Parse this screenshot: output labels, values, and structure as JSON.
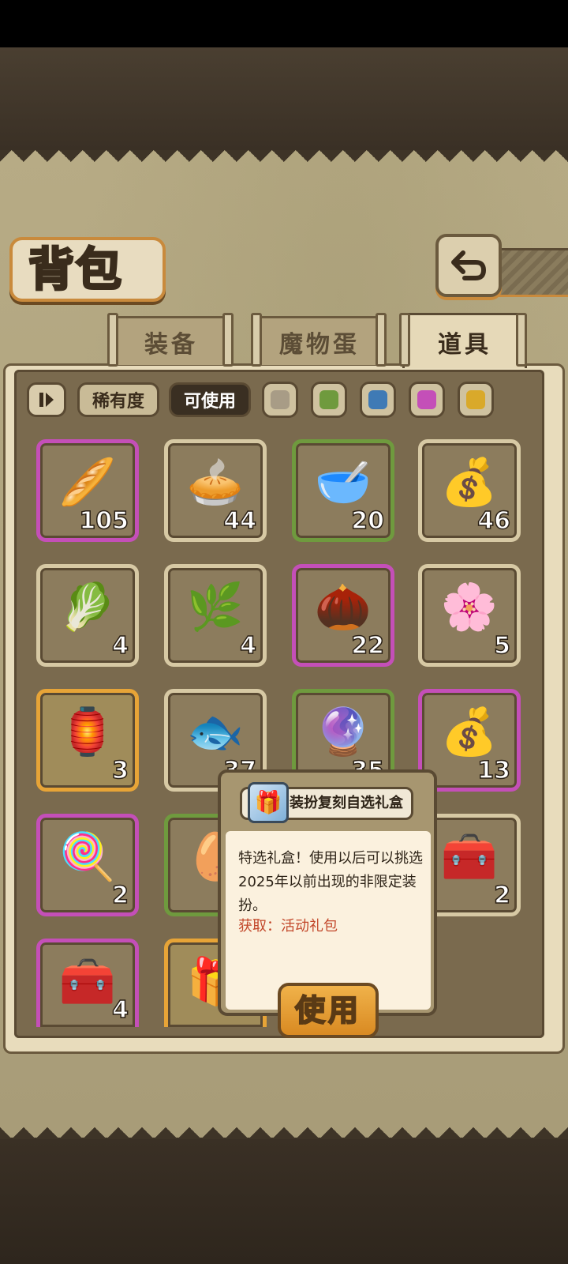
{
  "header": {
    "title": "背包"
  },
  "tabs": [
    {
      "label": "装备",
      "active": false
    },
    {
      "label": "魔物蛋",
      "active": false
    },
    {
      "label": "道具",
      "active": true
    }
  ],
  "filters": {
    "rarity_label": "稀有度",
    "usable_label": "可使用",
    "swatch_colors": [
      "#a89c86",
      "#6f9a3e",
      "#3f7ab5",
      "#c44fb8",
      "#d9a92a"
    ]
  },
  "items": [
    {
      "icon": "bread-basket-icon",
      "glyph": "🥖",
      "count": "105",
      "rarity": "purple"
    },
    {
      "icon": "seaweed-pie-icon",
      "glyph": "🥧",
      "count": "44",
      "rarity": "common"
    },
    {
      "icon": "water-bowl-icon",
      "glyph": "🥣",
      "count": "20",
      "rarity": "green"
    },
    {
      "icon": "coin-sack-icon",
      "glyph": "💰",
      "count": "46",
      "rarity": "common"
    },
    {
      "icon": "radish-icon",
      "glyph": "🥬",
      "count": "4",
      "rarity": "common"
    },
    {
      "icon": "kelp-icon",
      "glyph": "🌿",
      "count": "4",
      "rarity": "common"
    },
    {
      "icon": "seed-icon",
      "glyph": "🌰",
      "count": "22",
      "rarity": "purple"
    },
    {
      "icon": "pink-petal-icon",
      "glyph": "🌸",
      "count": "5",
      "rarity": "common"
    },
    {
      "icon": "winged-lantern-icon",
      "glyph": "🏮",
      "count": "3",
      "rarity": "gold"
    },
    {
      "icon": "dried-fish-icon",
      "glyph": "🐟",
      "count": "37",
      "rarity": "common"
    },
    {
      "icon": "rainbow-orb-icon",
      "glyph": "🔮",
      "count": "35",
      "rarity": "green"
    },
    {
      "icon": "treasure-bag-icon",
      "glyph": "💰",
      "count": "13",
      "rarity": "purple"
    },
    {
      "icon": "rainbow-popsicle-icon",
      "glyph": "🍭",
      "count": "2",
      "rarity": "purple"
    },
    {
      "icon": "eggs-icon",
      "glyph": "🥚",
      "count": "",
      "rarity": "green"
    },
    {
      "icon": "hidden-slot",
      "glyph": "",
      "count": "",
      "rarity": "common"
    },
    {
      "icon": "wooden-chest-icon",
      "glyph": "🧰",
      "count": "2",
      "rarity": "common"
    },
    {
      "icon": "red-chest-icon",
      "glyph": "🧰",
      "count": "4",
      "rarity": "purple"
    },
    {
      "icon": "gift-box-icon",
      "glyph": "🎁",
      "count": "",
      "rarity": "gold"
    }
  ],
  "tooltip": {
    "title": "装扮复刻自选礼盒",
    "icon": "gift-box-icon",
    "description": "特选礼盒！使用以后可以挑选2025年以前出现的非限定装扮。",
    "source": "获取：活动礼包",
    "use_label": "使用"
  }
}
